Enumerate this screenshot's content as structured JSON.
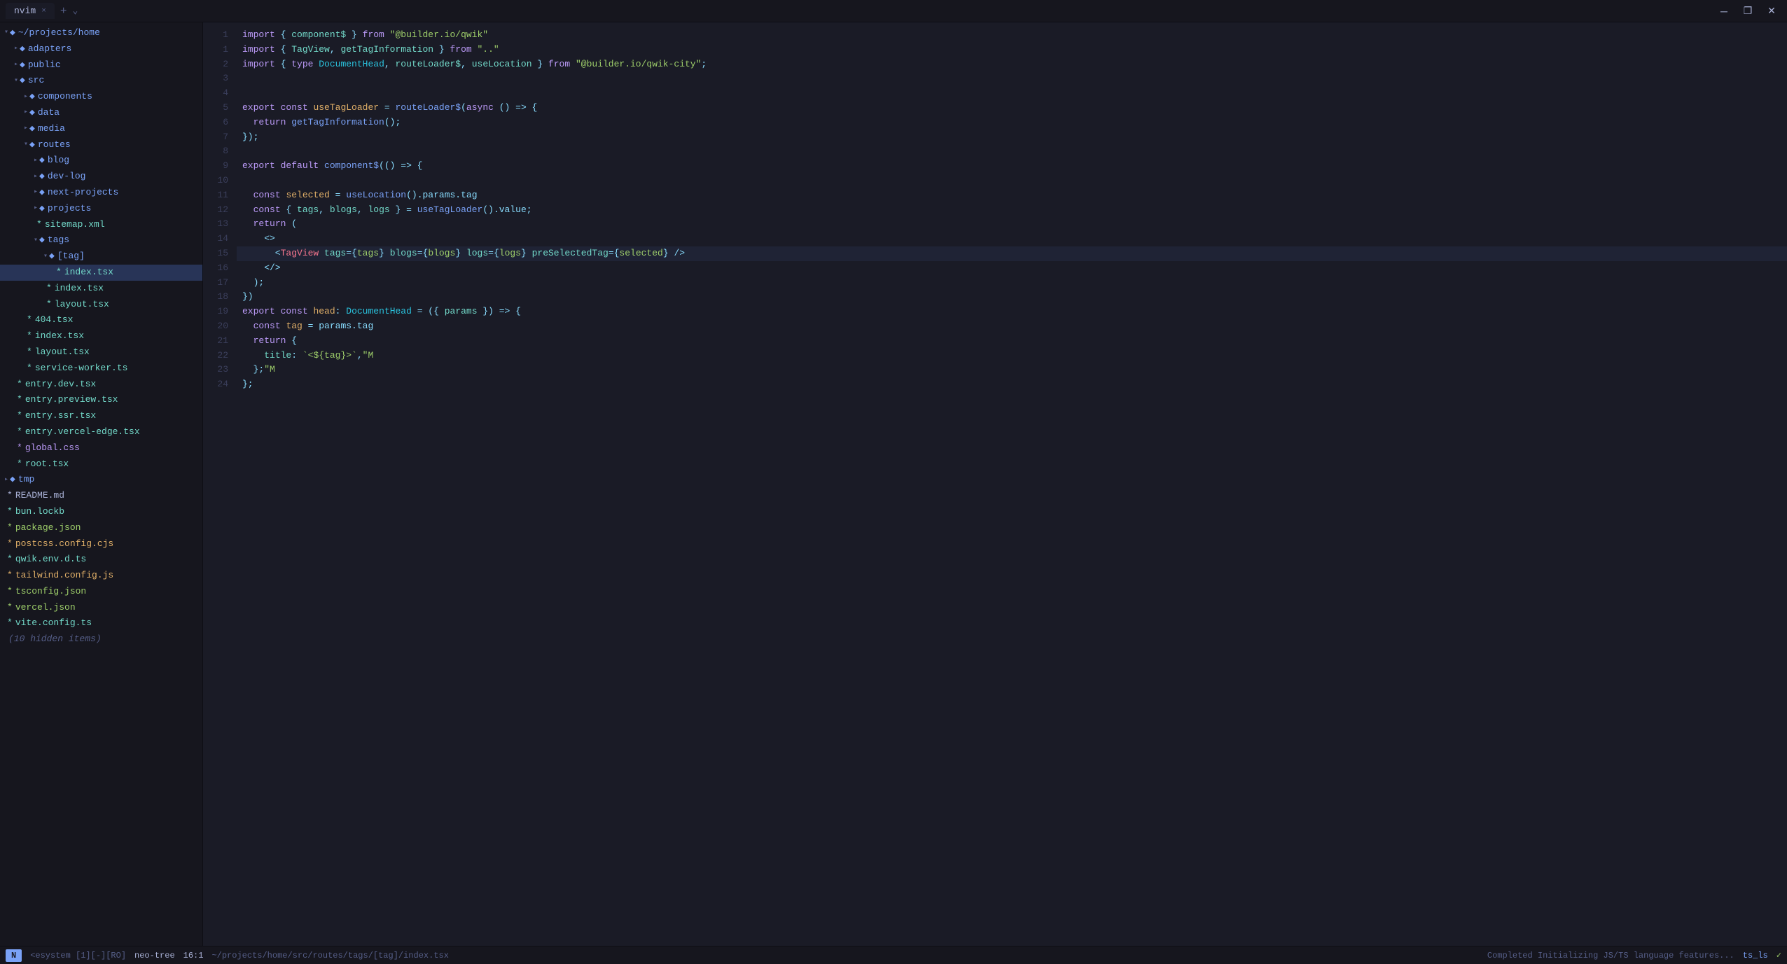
{
  "titlebar": {
    "tab_label": "nvim",
    "close_label": "×",
    "new_tab_label": "+",
    "chevron_label": "⌄",
    "minimize_label": "─",
    "restore_label": "❐",
    "maximize_label": "✕"
  },
  "sidebar": {
    "items": [
      {
        "id": "root",
        "label": "~/projects/home",
        "indent": 0,
        "type": "dir-open",
        "icon": "◆",
        "chevron": "▾"
      },
      {
        "id": "adapters",
        "label": "adapters",
        "indent": 1,
        "type": "dir",
        "icon": "◆",
        "chevron": "▸"
      },
      {
        "id": "public",
        "label": "public",
        "indent": 1,
        "type": "dir",
        "icon": "◆",
        "chevron": "▸"
      },
      {
        "id": "src",
        "label": "src",
        "indent": 1,
        "type": "dir-open",
        "icon": "◆",
        "chevron": "▾"
      },
      {
        "id": "components",
        "label": "components",
        "indent": 2,
        "type": "dir",
        "icon": "◆",
        "chevron": "▸"
      },
      {
        "id": "data",
        "label": "data",
        "indent": 2,
        "type": "dir",
        "icon": "◆",
        "chevron": "▸"
      },
      {
        "id": "media",
        "label": "media",
        "indent": 2,
        "type": "dir",
        "icon": "◆",
        "chevron": "▸"
      },
      {
        "id": "routes",
        "label": "routes",
        "indent": 2,
        "type": "dir-open",
        "icon": "◆",
        "chevron": "▾"
      },
      {
        "id": "blog",
        "label": "blog",
        "indent": 3,
        "type": "dir",
        "icon": "◆",
        "chevron": "▸"
      },
      {
        "id": "dev-log",
        "label": "dev-log",
        "indent": 3,
        "type": "dir",
        "icon": "◆",
        "chevron": "▸"
      },
      {
        "id": "next-projects",
        "label": "next-projects",
        "indent": 3,
        "type": "dir",
        "icon": "◆",
        "chevron": "▸"
      },
      {
        "id": "projects",
        "label": "projects",
        "indent": 3,
        "type": "dir",
        "icon": "◆",
        "chevron": "▸"
      },
      {
        "id": "sitemap",
        "label": "sitemap.xml",
        "indent": 3,
        "type": "file",
        "icon": "*",
        "color": "tsx"
      },
      {
        "id": "tags-dir",
        "label": "tags",
        "indent": 3,
        "type": "dir-open",
        "icon": "◆",
        "chevron": "▾"
      },
      {
        "id": "tag-dir",
        "label": "[tag]",
        "indent": 4,
        "type": "dir-open",
        "icon": "◆",
        "chevron": "▾"
      },
      {
        "id": "tag-index",
        "label": "index.tsx",
        "indent": 5,
        "type": "file-sel",
        "icon": "*",
        "color": "tsx",
        "selected": true
      },
      {
        "id": "tags-index",
        "label": "index.tsx",
        "indent": 4,
        "type": "file-mod",
        "icon": "*",
        "color": "tsx"
      },
      {
        "id": "tags-layout",
        "label": "layout.tsx",
        "indent": 4,
        "type": "file",
        "icon": "*",
        "color": "tsx"
      },
      {
        "id": "f404",
        "label": "404.tsx",
        "indent": 2,
        "type": "file",
        "icon": "*",
        "color": "tsx"
      },
      {
        "id": "src-index",
        "label": "index.tsx",
        "indent": 2,
        "type": "file",
        "icon": "*",
        "color": "tsx"
      },
      {
        "id": "src-layout",
        "label": "layout.tsx",
        "indent": 2,
        "type": "file",
        "icon": "*",
        "color": "tsx"
      },
      {
        "id": "svcwrkr",
        "label": "service-worker.ts",
        "indent": 2,
        "type": "file",
        "icon": "*",
        "color": "tsx"
      },
      {
        "id": "entry-dev",
        "label": "entry.dev.tsx",
        "indent": 1,
        "type": "file",
        "icon": "*",
        "color": "tsx"
      },
      {
        "id": "entry-prev",
        "label": "entry.preview.tsx",
        "indent": 1,
        "type": "file",
        "icon": "*",
        "color": "tsx"
      },
      {
        "id": "entry-ssr",
        "label": "entry.ssr.tsx",
        "indent": 1,
        "type": "file",
        "icon": "*",
        "color": "tsx"
      },
      {
        "id": "entry-verc",
        "label": "entry.vercel-edge.tsx",
        "indent": 1,
        "type": "file",
        "icon": "*",
        "color": "tsx"
      },
      {
        "id": "global-css",
        "label": "global.css",
        "indent": 1,
        "type": "file",
        "icon": "*",
        "color": "css"
      },
      {
        "id": "root-tsx",
        "label": "root.tsx",
        "indent": 1,
        "type": "file",
        "icon": "*",
        "color": "tsx"
      },
      {
        "id": "tmp",
        "label": "tmp",
        "indent": 0,
        "type": "dir",
        "icon": "◆",
        "chevron": "▸"
      },
      {
        "id": "readme",
        "label": "README.md",
        "indent": 0,
        "type": "file",
        "icon": "*",
        "color": "md"
      },
      {
        "id": "bunlockb",
        "label": "bun.lockb",
        "indent": 0,
        "type": "file",
        "icon": "*",
        "color": "tsx"
      },
      {
        "id": "pkgjson",
        "label": "package.json",
        "indent": 0,
        "type": "file",
        "icon": "*",
        "color": "json"
      },
      {
        "id": "postcss",
        "label": "postcss.config.cjs",
        "indent": 0,
        "type": "file",
        "icon": "*",
        "color": "js"
      },
      {
        "id": "qwikenv",
        "label": "qwik.env.d.ts",
        "indent": 0,
        "type": "file",
        "icon": "*",
        "color": "tsx"
      },
      {
        "id": "tailwind",
        "label": "tailwind.config.js",
        "indent": 0,
        "type": "file",
        "icon": "*",
        "color": "js"
      },
      {
        "id": "tsconfig",
        "label": "tsconfig.json",
        "indent": 0,
        "type": "file",
        "icon": "*",
        "color": "json"
      },
      {
        "id": "vercel",
        "label": "vercel.json",
        "indent": 0,
        "type": "file",
        "icon": "*",
        "color": "json"
      },
      {
        "id": "vite",
        "label": "vite.config.ts",
        "indent": 0,
        "type": "file",
        "icon": "*",
        "color": "tsx"
      },
      {
        "id": "hidden",
        "label": "(10 hidden items)",
        "indent": 0,
        "type": "hidden",
        "icon": ""
      }
    ]
  },
  "editor": {
    "filename": "index.tsx",
    "lines": [
      {
        "n": 1,
        "tokens": [
          {
            "t": "kw",
            "v": "import"
          },
          {
            "t": "op",
            "v": " { "
          },
          {
            "t": "prop-name",
            "v": "component$"
          },
          {
            "t": "op",
            "v": " } "
          },
          {
            "t": "kw",
            "v": "from"
          },
          {
            "t": "op",
            "v": " "
          },
          {
            "t": "str",
            "v": "\"@builder.io/qwik\""
          }
        ]
      },
      {
        "n": 1,
        "tokens": [
          {
            "t": "kw",
            "v": "import"
          },
          {
            "t": "op",
            "v": " { "
          },
          {
            "t": "prop-name",
            "v": "TagView"
          },
          {
            "t": "op",
            "v": ", "
          },
          {
            "t": "prop-name",
            "v": "getTagInformation"
          },
          {
            "t": "op",
            "v": " } "
          },
          {
            "t": "kw",
            "v": "from"
          },
          {
            "t": "op",
            "v": " "
          },
          {
            "t": "str",
            "v": "\"..\""
          }
        ]
      },
      {
        "n": 2,
        "tokens": [
          {
            "t": "kw",
            "v": "import"
          },
          {
            "t": "op",
            "v": " { "
          },
          {
            "t": "kw",
            "v": "type"
          },
          {
            "t": "op",
            "v": " "
          },
          {
            "t": "typ",
            "v": "DocumentHead"
          },
          {
            "t": "op",
            "v": ", "
          },
          {
            "t": "prop-name",
            "v": "routeLoader$"
          },
          {
            "t": "op",
            "v": ", "
          },
          {
            "t": "prop-name",
            "v": "useLocation"
          },
          {
            "t": "op",
            "v": " } "
          },
          {
            "t": "kw",
            "v": "from"
          },
          {
            "t": "op",
            "v": " "
          },
          {
            "t": "str",
            "v": "\"@builder.io/qwik-city\""
          },
          {
            "t": "op",
            "v": ";"
          }
        ]
      },
      {
        "n": 3,
        "tokens": []
      },
      {
        "n": 4,
        "tokens": []
      },
      {
        "n": 5,
        "tokens": [
          {
            "t": "kw",
            "v": "export"
          },
          {
            "t": "op",
            "v": " "
          },
          {
            "t": "kw",
            "v": "const"
          },
          {
            "t": "op",
            "v": " "
          },
          {
            "t": "var",
            "v": "useTagLoader"
          },
          {
            "t": "op",
            "v": " = "
          },
          {
            "t": "fn",
            "v": "routeLoader$"
          },
          {
            "t": "op",
            "v": "("
          },
          {
            "t": "kw",
            "v": "async"
          },
          {
            "t": "op",
            "v": " () => {"
          }
        ]
      },
      {
        "n": 6,
        "tokens": [
          {
            "t": "op",
            "v": "  "
          },
          {
            "t": "kw",
            "v": "return"
          },
          {
            "t": "op",
            "v": " "
          },
          {
            "t": "fn",
            "v": "getTagInformation"
          },
          {
            "t": "op",
            "v": "();"
          }
        ]
      },
      {
        "n": 7,
        "tokens": [
          {
            "t": "op",
            "v": "});"
          }
        ]
      },
      {
        "n": 8,
        "tokens": []
      },
      {
        "n": 9,
        "tokens": [
          {
            "t": "kw",
            "v": "export"
          },
          {
            "t": "op",
            "v": " "
          },
          {
            "t": "kw",
            "v": "default"
          },
          {
            "t": "op",
            "v": " "
          },
          {
            "t": "fn",
            "v": "component$"
          },
          {
            "t": "op",
            "v": "(() => {"
          }
        ]
      },
      {
        "n": 10,
        "tokens": []
      },
      {
        "n": 11,
        "tokens": [
          {
            "t": "op",
            "v": "  "
          },
          {
            "t": "kw",
            "v": "const"
          },
          {
            "t": "op",
            "v": " "
          },
          {
            "t": "var",
            "v": "selected"
          },
          {
            "t": "op",
            "v": " = "
          },
          {
            "t": "fn",
            "v": "useLocation"
          },
          {
            "t": "op",
            "v": "().params.tag"
          }
        ]
      },
      {
        "n": 12,
        "tokens": [
          {
            "t": "op",
            "v": "  "
          },
          {
            "t": "kw",
            "v": "const"
          },
          {
            "t": "op",
            "v": " { "
          },
          {
            "t": "prop-name",
            "v": "tags"
          },
          {
            "t": "op",
            "v": ", "
          },
          {
            "t": "prop-name",
            "v": "blogs"
          },
          {
            "t": "op",
            "v": ", "
          },
          {
            "t": "prop-name",
            "v": "logs"
          },
          {
            "t": "op",
            "v": " } = "
          },
          {
            "t": "fn",
            "v": "useTagLoader"
          },
          {
            "t": "op",
            "v": "().value;"
          }
        ]
      },
      {
        "n": 13,
        "tokens": [
          {
            "t": "op",
            "v": "  "
          },
          {
            "t": "kw",
            "v": "return"
          },
          {
            "t": "op",
            "v": " ("
          }
        ]
      },
      {
        "n": 14,
        "tokens": [
          {
            "t": "op",
            "v": "    <>"
          }
        ]
      },
      {
        "n": 15,
        "tokens": [
          {
            "t": "op",
            "v": "      <"
          },
          {
            "t": "tag-name",
            "v": "TagView"
          },
          {
            "t": "op",
            "v": " "
          },
          {
            "t": "attr-name",
            "v": "tags"
          },
          {
            "t": "op",
            "v": "={"
          },
          {
            "t": "attr-val",
            "v": "tags"
          },
          {
            "t": "op",
            "v": "} "
          },
          {
            "t": "attr-name",
            "v": "blogs"
          },
          {
            "t": "op",
            "v": "={"
          },
          {
            "t": "attr-val",
            "v": "blogs"
          },
          {
            "t": "op",
            "v": "} "
          },
          {
            "t": "attr-name",
            "v": "logs"
          },
          {
            "t": "op",
            "v": "={"
          },
          {
            "t": "attr-val",
            "v": "logs"
          },
          {
            "t": "op",
            "v": "} "
          },
          {
            "t": "attr-name",
            "v": "preSelectedTag"
          },
          {
            "t": "op",
            "v": "={"
          },
          {
            "t": "attr-val",
            "v": "selected"
          },
          {
            "t": "op",
            "v": "} />"
          }
        ]
      },
      {
        "n": 16,
        "tokens": [
          {
            "t": "op",
            "v": "    </>"
          }
        ]
      },
      {
        "n": 17,
        "tokens": [
          {
            "t": "op",
            "v": "  );"
          }
        ]
      },
      {
        "n": 18,
        "tokens": [
          {
            "t": "op",
            "v": "})"
          }
        ]
      },
      {
        "n": 19,
        "tokens": [
          {
            "t": "kw",
            "v": "export"
          },
          {
            "t": "op",
            "v": " "
          },
          {
            "t": "kw",
            "v": "const"
          },
          {
            "t": "op",
            "v": " "
          },
          {
            "t": "var",
            "v": "head"
          },
          {
            "t": "op",
            "v": ": "
          },
          {
            "t": "typ",
            "v": "DocumentHead"
          },
          {
            "t": "op",
            "v": " = ({ "
          },
          {
            "t": "prop-name",
            "v": "params"
          },
          {
            "t": "op",
            "v": " }) => {"
          }
        ]
      },
      {
        "n": 20,
        "tokens": [
          {
            "t": "op",
            "v": "  "
          },
          {
            "t": "kw",
            "v": "const"
          },
          {
            "t": "op",
            "v": " "
          },
          {
            "t": "var",
            "v": "tag"
          },
          {
            "t": "op",
            "v": " = params.tag"
          }
        ]
      },
      {
        "n": 21,
        "tokens": [
          {
            "t": "op",
            "v": "  "
          },
          {
            "t": "kw",
            "v": "return"
          },
          {
            "t": "op",
            "v": " {"
          }
        ]
      },
      {
        "n": 22,
        "tokens": [
          {
            "t": "op",
            "v": "    "
          },
          {
            "t": "prop-name",
            "v": "title"
          },
          {
            "t": "op",
            "v": ": "
          },
          {
            "t": "str",
            "v": "`<${tag}>`"
          },
          {
            "t": "op",
            "v": ","
          },
          {
            "t": "str",
            "v": "\"M"
          }
        ]
      },
      {
        "n": 23,
        "tokens": [
          {
            "t": "op",
            "v": "  };"
          },
          {
            "t": "str",
            "v": "\"M"
          }
        ]
      },
      {
        "n": 24,
        "tokens": [
          {
            "t": "op",
            "v": "};"
          }
        ]
      }
    ],
    "active_line": 15
  },
  "statusbar": {
    "mode": "N",
    "session": "<esystem [1][-][RO]",
    "tree": "neo-tree",
    "cursor": "16:1",
    "filepath": "~/projects/home/src/routes/tags/[tag]/index.tsx",
    "notification": "Completed Initializing JS/TS language features...",
    "language": "ts_ls",
    "check_icon": "✓"
  }
}
